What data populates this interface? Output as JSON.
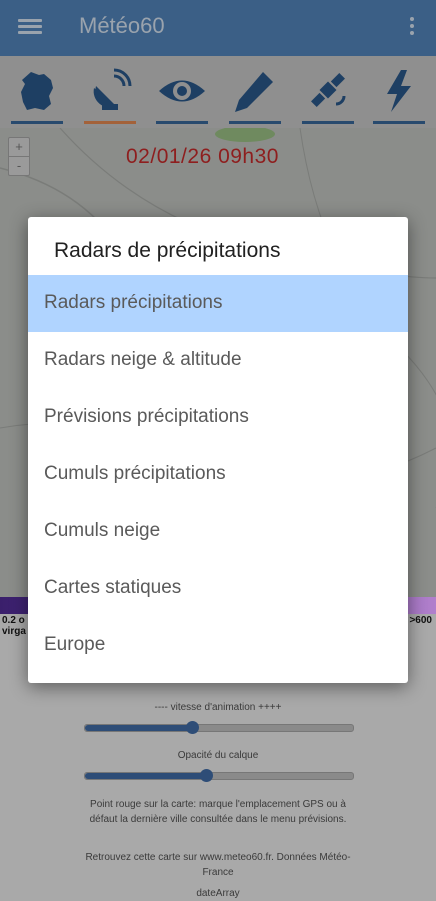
{
  "app": {
    "title": "Météo60"
  },
  "toolbar": {
    "tools": [
      {
        "name": "france-map-icon",
        "active": false
      },
      {
        "name": "satellite-dish-icon",
        "active": true
      },
      {
        "name": "eye-icon",
        "active": false
      },
      {
        "name": "pencil-icon",
        "active": false
      },
      {
        "name": "satellite-icon",
        "active": false
      },
      {
        "name": "lightning-icon",
        "active": false
      }
    ]
  },
  "map": {
    "zoom_in": "+",
    "zoom_out": "-",
    "timestamp": "02/01/26 09h30",
    "legend_left_line1": "0.2 o",
    "legend_left_line2": "virga",
    "legend_right": ">600"
  },
  "controls": {
    "speed_label": "---- vitesse d'animation ++++",
    "speed_value": 0.4,
    "opacity_label": "Opacité du calque",
    "opacity_value": 0.45,
    "info1": "Point rouge sur la carte: marque l'emplacement GPS ou à défaut la dernière ville consultée dans le menu prévisions.",
    "info2": "Retrouvez cette carte sur www.meteo60.fr. Données Météo-France",
    "info3": "dateArray"
  },
  "dialog": {
    "title": "Radars de précipitations",
    "options": [
      "Radars précipitations",
      "Radars neige & altitude",
      "Prévisions précipitations",
      "Cumuls précipitations",
      "Cumuls neige",
      "Cartes statiques",
      "Europe"
    ],
    "selected_index": 0
  },
  "colors": {
    "appbar": "#3b5f86",
    "selected_option": "#b0d4ff",
    "timestamp": "#8e1e1e"
  }
}
